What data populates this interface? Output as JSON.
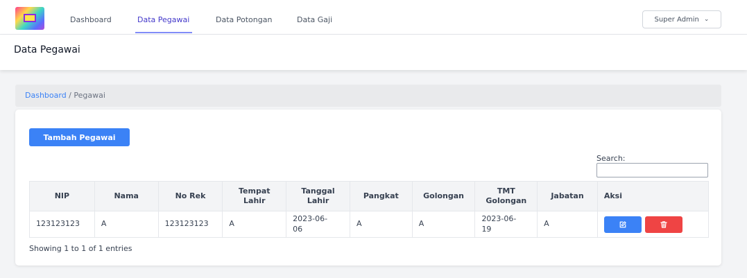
{
  "nav": {
    "items": [
      {
        "label": "Dashboard"
      },
      {
        "label": "Data Pegawai"
      },
      {
        "label": "Data Potongan"
      },
      {
        "label": "Data Gaji"
      }
    ],
    "user_menu": "Super Admin"
  },
  "page": {
    "title": "Data Pegawai"
  },
  "breadcrumb": {
    "home": "Dashboard",
    "separator": " / ",
    "current": "Pegawai"
  },
  "actions": {
    "add_label": "Tambah Pegawai"
  },
  "search": {
    "label": "Search:",
    "value": ""
  },
  "table": {
    "headers": {
      "nip": "NIP",
      "nama": "Nama",
      "norek": "No Rek",
      "tempat_1": "Tempat",
      "tempat_2": "Lahir",
      "tanggal_1": "Tanggal",
      "tanggal_2": "Lahir",
      "pangkat": "Pangkat",
      "golongan": "Golongan",
      "tmt_1": "TMT",
      "tmt_2": "Golongan",
      "jabatan": "Jabatan",
      "aksi": "Aksi"
    },
    "rows": [
      {
        "nip": "123123123",
        "nama": "A",
        "norek": "123123123",
        "tempat_lahir": "A",
        "tanggal_lahir_1": "2023-06-",
        "tanggal_lahir_2": "06",
        "pangkat": "A",
        "golongan": "A",
        "tmt_1": "2023-06-",
        "tmt_2": "19",
        "jabatan": "A"
      }
    ]
  },
  "footer": {
    "info": "Showing 1 to 1 of 1 entries"
  },
  "colors": {
    "primary": "#3b82f6",
    "danger": "#ef4444",
    "nav_active": "#4338ca"
  },
  "icons": {
    "edit": "edit-icon",
    "delete": "trash-icon",
    "user_menu": "chevron-down-icon"
  }
}
